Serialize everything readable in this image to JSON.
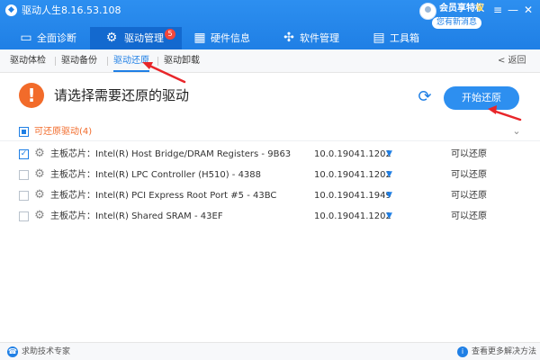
{
  "app": {
    "title": "驱动人生8.16.53.108",
    "vip_label": "会员享特权",
    "message_badge": "您有新消息"
  },
  "window_controls": [
    "≡",
    "—",
    "✕"
  ],
  "tabs": [
    {
      "label": "全面诊断",
      "icon": "monitor-icon"
    },
    {
      "label": "驱动管理",
      "icon": "gear-icon",
      "badge": "5",
      "active": true
    },
    {
      "label": "硬件信息",
      "icon": "chip-icon"
    },
    {
      "label": "软件管理",
      "icon": "apps-icon"
    },
    {
      "label": "工具箱",
      "icon": "toolbox-icon"
    }
  ],
  "subnav": {
    "items": [
      "驱动体检",
      "驱动备份",
      "驱动还原",
      "驱动卸载"
    ],
    "active": "驱动还原",
    "back_label": "< 返回"
  },
  "header": {
    "title": "请选择需要还原的驱动",
    "start_button": "开始还原"
  },
  "group": {
    "label": "可还原驱动(4)"
  },
  "drivers": [
    {
      "category": "主板芯片：",
      "name": "Intel(R) Host Bridge/DRAM Registers - 9B63",
      "version": "10.0.19041.1202",
      "status": "可以还原",
      "checked": true
    },
    {
      "category": "主板芯片：",
      "name": "Intel(R) LPC Controller (H510) - 4388",
      "version": "10.0.19041.1202",
      "status": "可以还原",
      "checked": false
    },
    {
      "category": "主板芯片：",
      "name": "Intel(R) PCI Express Root Port #5 - 43BC",
      "version": "10.0.19041.1949",
      "status": "可以还原",
      "checked": false
    },
    {
      "category": "主板芯片：",
      "name": "Intel(R) Shared SRAM - 43EF",
      "version": "10.0.19041.1202",
      "status": "可以还原",
      "checked": false
    }
  ],
  "footer": {
    "left": "求助技术专家",
    "right": "查看更多解决方法"
  },
  "colors": {
    "primary": "#1f7fe5",
    "warning": "#f26b2a",
    "badge": "#f4473a",
    "annotation": "#e8262a"
  }
}
